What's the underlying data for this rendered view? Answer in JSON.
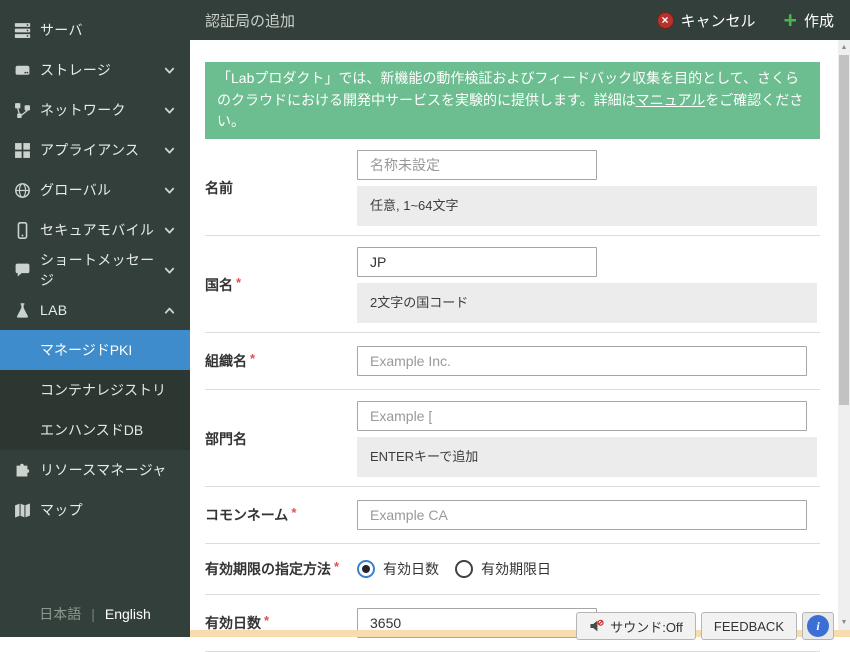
{
  "colors": {
    "sidebar_bg": "#333f3a",
    "submenu_bg": "#2c3732",
    "selected_blue": "#3e8ccc",
    "banner_green": "#6cbd8f",
    "cancel_red": "#b5332c",
    "create_green": "#4ab54e",
    "bottom_strip_orange": "#f8dcae",
    "help_blue": "#3b6fd6"
  },
  "sidebar": {
    "items": [
      {
        "name": "server",
        "label": "サーバ",
        "icon": "server-icon",
        "chevron": null
      },
      {
        "name": "storage",
        "label": "ストレージ",
        "icon": "storage-icon",
        "chevron": "down"
      },
      {
        "name": "network",
        "label": "ネットワーク",
        "icon": "network-icon",
        "chevron": "down"
      },
      {
        "name": "appliance",
        "label": "アプライアンス",
        "icon": "appliance-icon",
        "chevron": "down"
      },
      {
        "name": "global",
        "label": "グローバル",
        "icon": "globe-icon",
        "chevron": "down"
      },
      {
        "name": "secure-mobile",
        "label": "セキュアモバイル",
        "icon": "mobile-icon",
        "chevron": "down"
      },
      {
        "name": "short-message",
        "label": "ショートメッセージ",
        "icon": "chat-bubble-icon",
        "chevron": "down"
      },
      {
        "name": "lab",
        "label": "LAB",
        "icon": "flask-icon",
        "chevron": "up",
        "submenu": [
          {
            "name": "managed-pki",
            "label": "マネージドPKI",
            "selected": true
          },
          {
            "name": "container-registry",
            "label": "コンテナレジストリ",
            "selected": false
          },
          {
            "name": "enhanced-db",
            "label": "エンハンスドDB",
            "selected": false
          }
        ]
      },
      {
        "name": "resource-manager",
        "label": "リソースマネージャ",
        "icon": "puzzle-icon",
        "chevron": null
      },
      {
        "name": "map",
        "label": "マップ",
        "icon": "map-icon",
        "chevron": null
      }
    ],
    "language": {
      "japanese": "日本語",
      "separator": "|",
      "english": "English"
    }
  },
  "header": {
    "title": "認証局の追加",
    "cancel_label": "キャンセル",
    "create_label": "作成"
  },
  "notice": {
    "text_before_link": "「Labプロダクト」では、新機能の動作検証およびフィードバック収集を目的として、さくらのクラウドにおける開発中サービスを実験的に提供します。詳細は",
    "link_label": "マニュアル",
    "text_after_link": "をご確認ください。"
  },
  "form": {
    "fields": [
      {
        "name": "name",
        "label": "名前",
        "required": false,
        "control": {
          "type": "text",
          "width": "narrow",
          "placeholder": "名称未設定",
          "value": ""
        },
        "helper": "任意, 1~64文字"
      },
      {
        "name": "country",
        "label": "国名",
        "required": true,
        "control": {
          "type": "text",
          "width": "narrow",
          "placeholder": "",
          "value": "JP"
        },
        "helper": "2文字の国コード"
      },
      {
        "name": "organization",
        "label": "組織名",
        "required": true,
        "control": {
          "type": "text",
          "width": "wide",
          "placeholder": "Example Inc.",
          "value": ""
        }
      },
      {
        "name": "department",
        "label": "部門名",
        "required": false,
        "control": {
          "type": "text",
          "width": "wide",
          "placeholder": "Example [",
          "value": ""
        },
        "helper": "ENTERキーで追加"
      },
      {
        "name": "common-name",
        "label": "コモンネーム",
        "required": true,
        "control": {
          "type": "text",
          "width": "wide",
          "placeholder": "Example CA",
          "value": ""
        }
      },
      {
        "name": "expiry-method",
        "label": "有効期限の指定方法",
        "required": true,
        "control": {
          "type": "radio-group",
          "options": [
            {
              "label": "有効日数",
              "selected": true
            },
            {
              "label": "有効期限日",
              "selected": false
            }
          ]
        }
      },
      {
        "name": "valid-days",
        "label": "有効日数",
        "required": true,
        "control": {
          "type": "text",
          "width": "narrow",
          "placeholder": "",
          "value": "3650"
        }
      }
    ],
    "required_mark": "*"
  },
  "footer": {
    "sound_label": "サウンド:Off",
    "feedback_label": "FEEDBACK",
    "help_label": "i"
  }
}
